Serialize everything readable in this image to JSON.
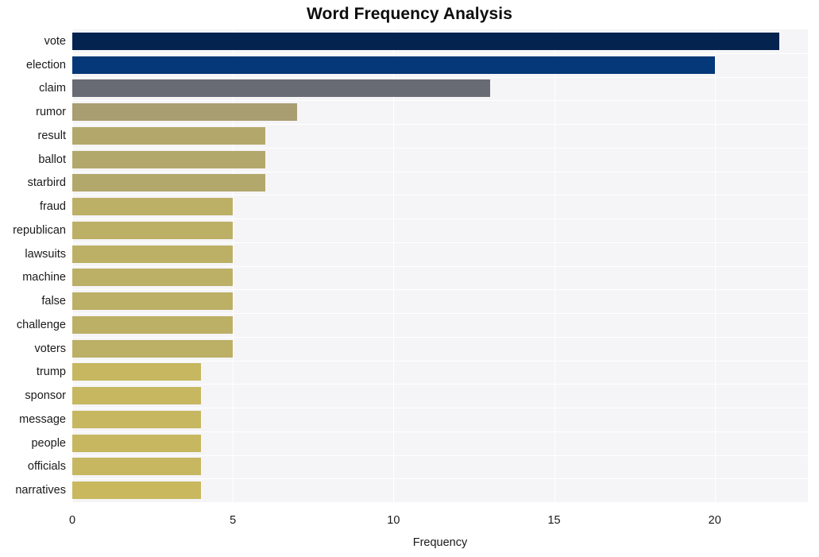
{
  "chart_data": {
    "type": "bar",
    "orientation": "horizontal",
    "title": "Word Frequency Analysis",
    "xlabel": "Frequency",
    "ylabel": "",
    "categories": [
      "vote",
      "election",
      "claim",
      "rumor",
      "result",
      "ballot",
      "starbird",
      "fraud",
      "republican",
      "lawsuits",
      "machine",
      "false",
      "challenge",
      "voters",
      "trump",
      "sponsor",
      "message",
      "people",
      "officials",
      "narratives"
    ],
    "values": [
      22,
      20,
      13,
      7,
      6,
      6,
      6,
      5,
      5,
      5,
      5,
      5,
      5,
      5,
      4,
      4,
      4,
      4,
      4,
      4
    ],
    "bar_colors": [
      "#04234f",
      "#043878",
      "#686b73",
      "#a89e72",
      "#b3a86b",
      "#b3a86b",
      "#b3a86b",
      "#bcaf66",
      "#bcaf66",
      "#bcaf66",
      "#bcaf66",
      "#bcaf66",
      "#bcaf66",
      "#bcaf66",
      "#c6b760",
      "#c6b760",
      "#c6b760",
      "#c6b760",
      "#c6b760",
      "#c9b85e"
    ],
    "xlim": [
      0,
      22.9
    ],
    "x_ticks": [
      0,
      5,
      10,
      15,
      20
    ],
    "x_tick_labels": [
      "0",
      "5",
      "10",
      "15",
      "20"
    ],
    "grid": true,
    "grid_color": "#ffffff",
    "plot_background": "#f5f5f7",
    "figure_background": "#ffffff",
    "legend": "none"
  }
}
